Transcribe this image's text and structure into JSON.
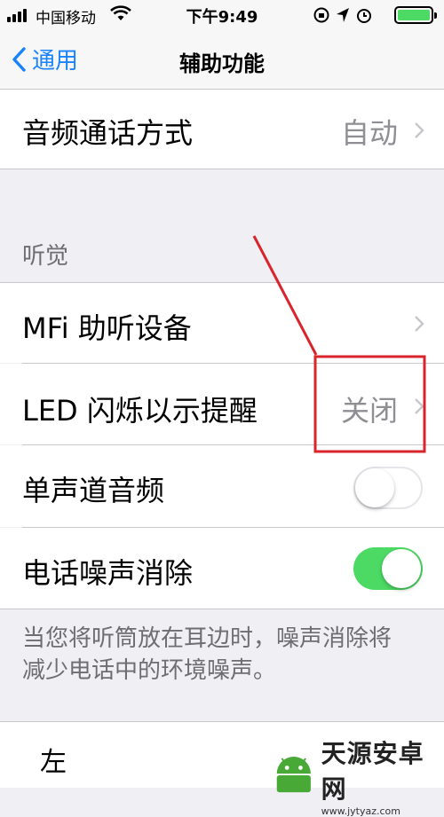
{
  "status": {
    "carrier": "中国移动",
    "time": "下午9:49"
  },
  "nav": {
    "back_label": "通用",
    "title": "辅助功能"
  },
  "rows": {
    "audio_call": {
      "label": "音频通话方式",
      "value": "自动"
    },
    "hearing_header": "听觉",
    "mfi": {
      "label": "MFi 助听设备"
    },
    "led": {
      "label": "LED 闪烁以示提醒",
      "value": "关闭"
    },
    "mono": {
      "label": "单声道音频",
      "enabled": false
    },
    "noise": {
      "label": "电话噪声消除",
      "enabled": true
    }
  },
  "footer_text": "当您将听筒放在耳边时，噪声消除将减少电话中的环境噪声。",
  "partial_row_label": "左",
  "watermark": {
    "title": "天源安卓网",
    "url": "www.jytyaz.com"
  },
  "colors": {
    "accent": "#1a82fb",
    "toggle_on": "#4cd964",
    "annotation": "#d9242c"
  },
  "icons": [
    "signal-icon",
    "wifi-icon",
    "lock-rotation-icon",
    "location-icon",
    "alarm-icon",
    "battery-icon",
    "back-chevron-icon",
    "chevron-right-icon"
  ]
}
